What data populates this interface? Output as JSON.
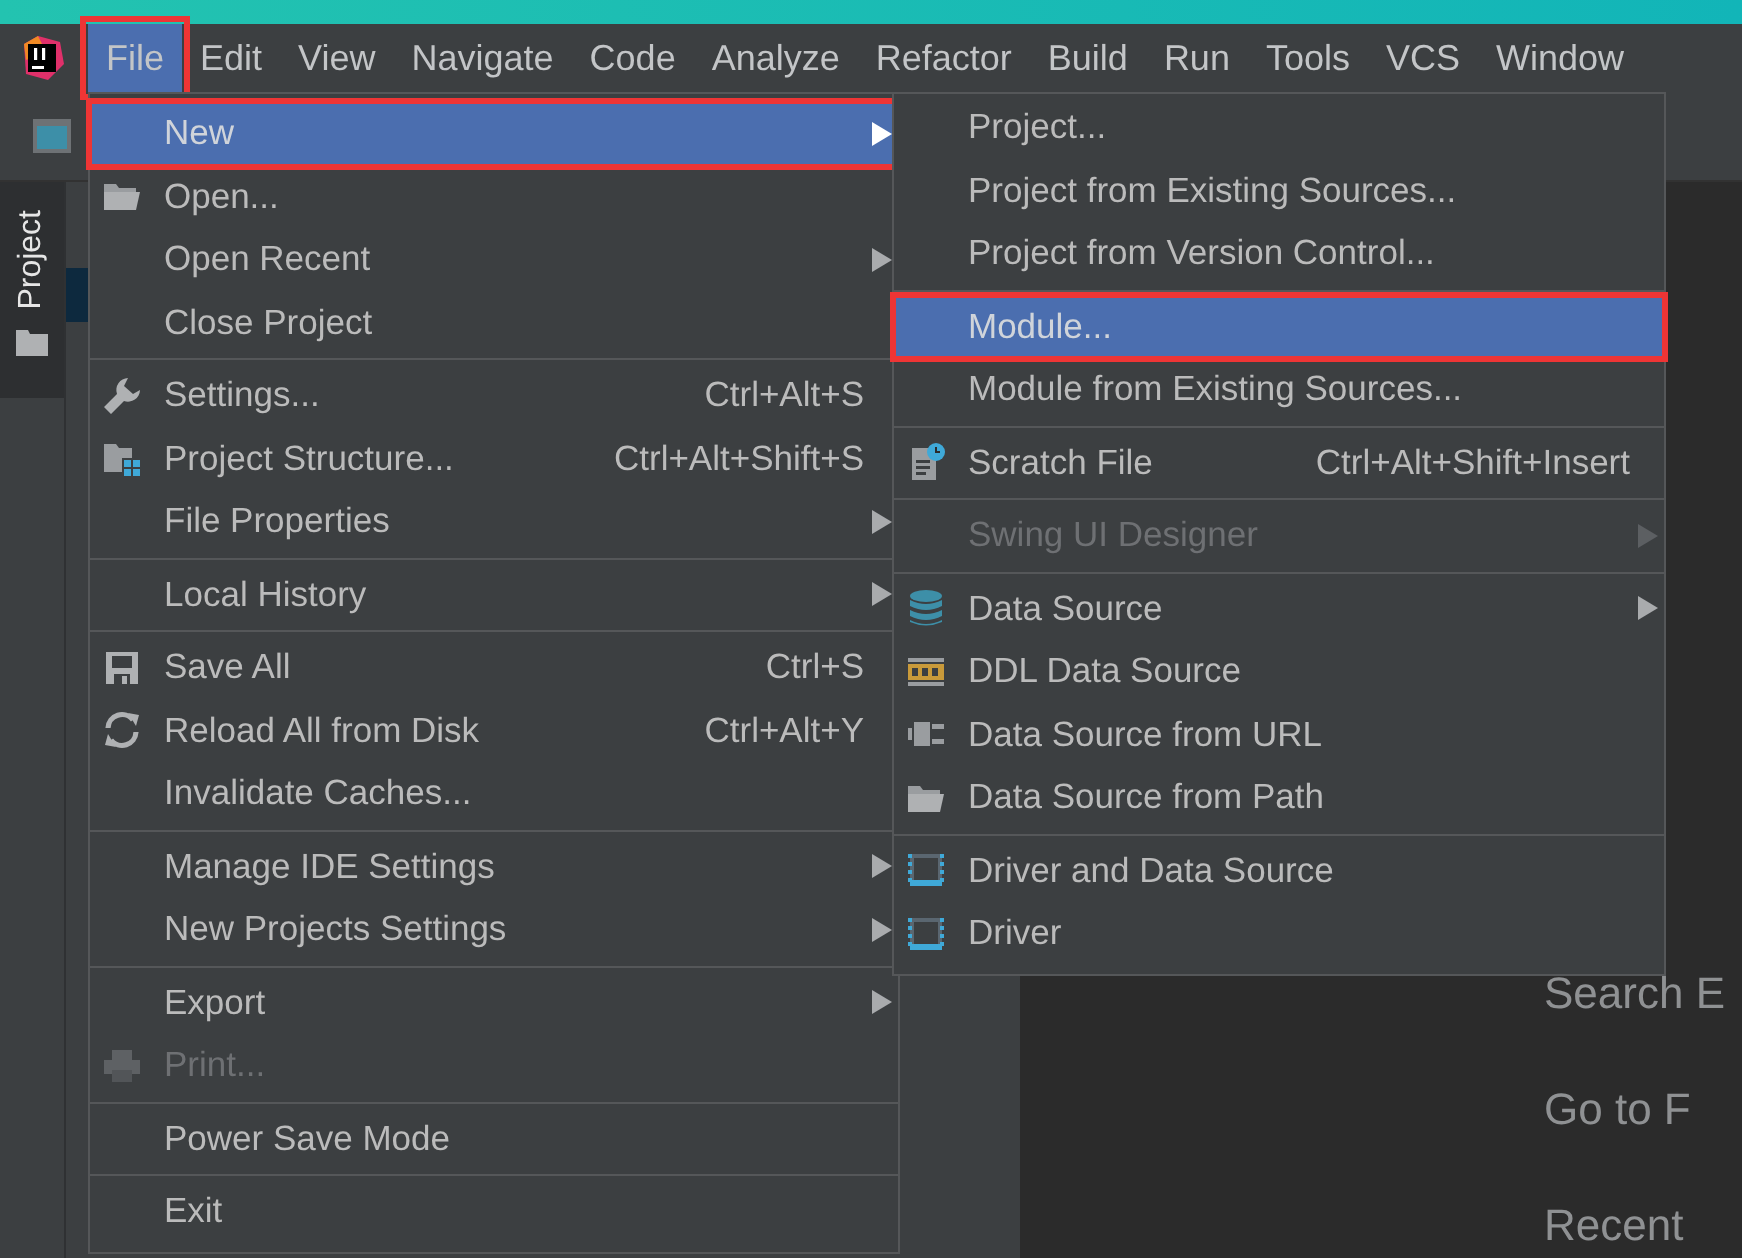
{
  "menubar": [
    {
      "label": "File",
      "selected": true,
      "annotated": true
    },
    {
      "label": "Edit",
      "selected": false,
      "annotated": false
    },
    {
      "label": "View",
      "selected": false,
      "annotated": false
    },
    {
      "label": "Navigate",
      "selected": false,
      "annotated": false
    },
    {
      "label": "Code",
      "selected": false,
      "annotated": false
    },
    {
      "label": "Analyze",
      "selected": false,
      "annotated": false
    },
    {
      "label": "Refactor",
      "selected": false,
      "annotated": false
    },
    {
      "label": "Build",
      "selected": false,
      "annotated": false
    },
    {
      "label": "Run",
      "selected": false,
      "annotated": false
    },
    {
      "label": "Tools",
      "selected": false,
      "annotated": false
    },
    {
      "label": "VCS",
      "selected": false,
      "annotated": false
    },
    {
      "label": "Window",
      "selected": false,
      "annotated": false
    }
  ],
  "tool_window_tab": {
    "label": "Project"
  },
  "file_menu": {
    "groups": [
      [
        {
          "label": "New",
          "submenu": true,
          "selected": true,
          "disabled": false,
          "annotated": true
        },
        {
          "label": "Open...",
          "kind": "folder",
          "submenu": false,
          "selected": false,
          "disabled": false,
          "annotated": false
        },
        {
          "label": "Open Recent",
          "submenu": true,
          "selected": false,
          "disabled": false,
          "annotated": false
        },
        {
          "label": "Close Project",
          "submenu": false,
          "selected": false,
          "disabled": false,
          "annotated": false
        }
      ],
      [
        {
          "label": "Settings...",
          "kind": "wrench",
          "shortcut": "Ctrl+Alt+S",
          "submenu": false,
          "selected": false,
          "disabled": false,
          "annotated": false
        },
        {
          "label": "Project Structure...",
          "kind": "structure",
          "shortcut": "Ctrl+Alt+Shift+S",
          "submenu": false,
          "selected": false,
          "disabled": false,
          "annotated": false
        },
        {
          "label": "File Properties",
          "submenu": true,
          "selected": false,
          "disabled": false,
          "annotated": false
        }
      ],
      [
        {
          "label": "Local History",
          "submenu": true,
          "selected": false,
          "disabled": false,
          "annotated": false
        }
      ],
      [
        {
          "label": "Save All",
          "kind": "save",
          "shortcut": "Ctrl+S",
          "submenu": false,
          "selected": false,
          "disabled": false,
          "annotated": false
        },
        {
          "label": "Reload All from Disk",
          "kind": "reload",
          "shortcut": "Ctrl+Alt+Y",
          "submenu": false,
          "selected": false,
          "disabled": false,
          "annotated": false
        },
        {
          "label": "Invalidate Caches...",
          "submenu": false,
          "selected": false,
          "disabled": false,
          "annotated": false
        }
      ],
      [
        {
          "label": "Manage IDE Settings",
          "submenu": true,
          "selected": false,
          "disabled": false,
          "annotated": false
        },
        {
          "label": "New Projects Settings",
          "submenu": true,
          "selected": false,
          "disabled": false,
          "annotated": false
        }
      ],
      [
        {
          "label": "Export",
          "submenu": true,
          "selected": false,
          "disabled": false,
          "annotated": false
        },
        {
          "label": "Print...",
          "kind": "printer",
          "submenu": false,
          "selected": false,
          "disabled": true,
          "annotated": false
        }
      ],
      [
        {
          "label": "Power Save Mode",
          "submenu": false,
          "selected": false,
          "disabled": false,
          "annotated": false
        }
      ],
      [
        {
          "label": "Exit",
          "submenu": false,
          "selected": false,
          "disabled": false,
          "annotated": false
        }
      ]
    ]
  },
  "new_submenu": {
    "groups": [
      [
        {
          "label": "Project...",
          "submenu": false,
          "selected": false,
          "disabled": false,
          "annotated": false
        },
        {
          "label": "Project from Existing Sources...",
          "submenu": false,
          "selected": false,
          "disabled": false,
          "annotated": false
        },
        {
          "label": "Project from Version Control...",
          "submenu": false,
          "selected": false,
          "disabled": false,
          "annotated": false
        }
      ],
      [
        {
          "label": "Module...",
          "submenu": false,
          "selected": true,
          "disabled": false,
          "annotated": true
        },
        {
          "label": "Module from Existing Sources...",
          "submenu": false,
          "selected": false,
          "disabled": false,
          "annotated": false
        }
      ],
      [
        {
          "label": "Scratch File",
          "kind": "scratch",
          "shortcut": "Ctrl+Alt+Shift+Insert",
          "submenu": false,
          "selected": false,
          "disabled": false,
          "annotated": false
        }
      ],
      [
        {
          "label": "Swing UI Designer",
          "submenu": true,
          "selected": false,
          "disabled": true,
          "annotated": false
        }
      ],
      [
        {
          "label": "Data Source",
          "kind": "database",
          "submenu": true,
          "selected": false,
          "disabled": false,
          "annotated": false
        },
        {
          "label": "DDL Data Source",
          "kind": "ddl",
          "submenu": false,
          "selected": false,
          "disabled": false,
          "annotated": false
        },
        {
          "label": "Data Source from URL",
          "kind": "plug",
          "submenu": false,
          "selected": false,
          "disabled": false,
          "annotated": false
        },
        {
          "label": "Data Source from Path",
          "kind": "folder",
          "submenu": false,
          "selected": false,
          "disabled": false,
          "annotated": false
        }
      ],
      [
        {
          "label": "Driver and Data Source",
          "kind": "driver",
          "submenu": false,
          "selected": false,
          "disabled": false,
          "annotated": false
        },
        {
          "label": "Driver",
          "kind": "driver",
          "submenu": false,
          "selected": false,
          "disabled": false,
          "annotated": false
        }
      ]
    ]
  },
  "editor_hints": [
    "Search E",
    "Go to F",
    "Recent"
  ]
}
